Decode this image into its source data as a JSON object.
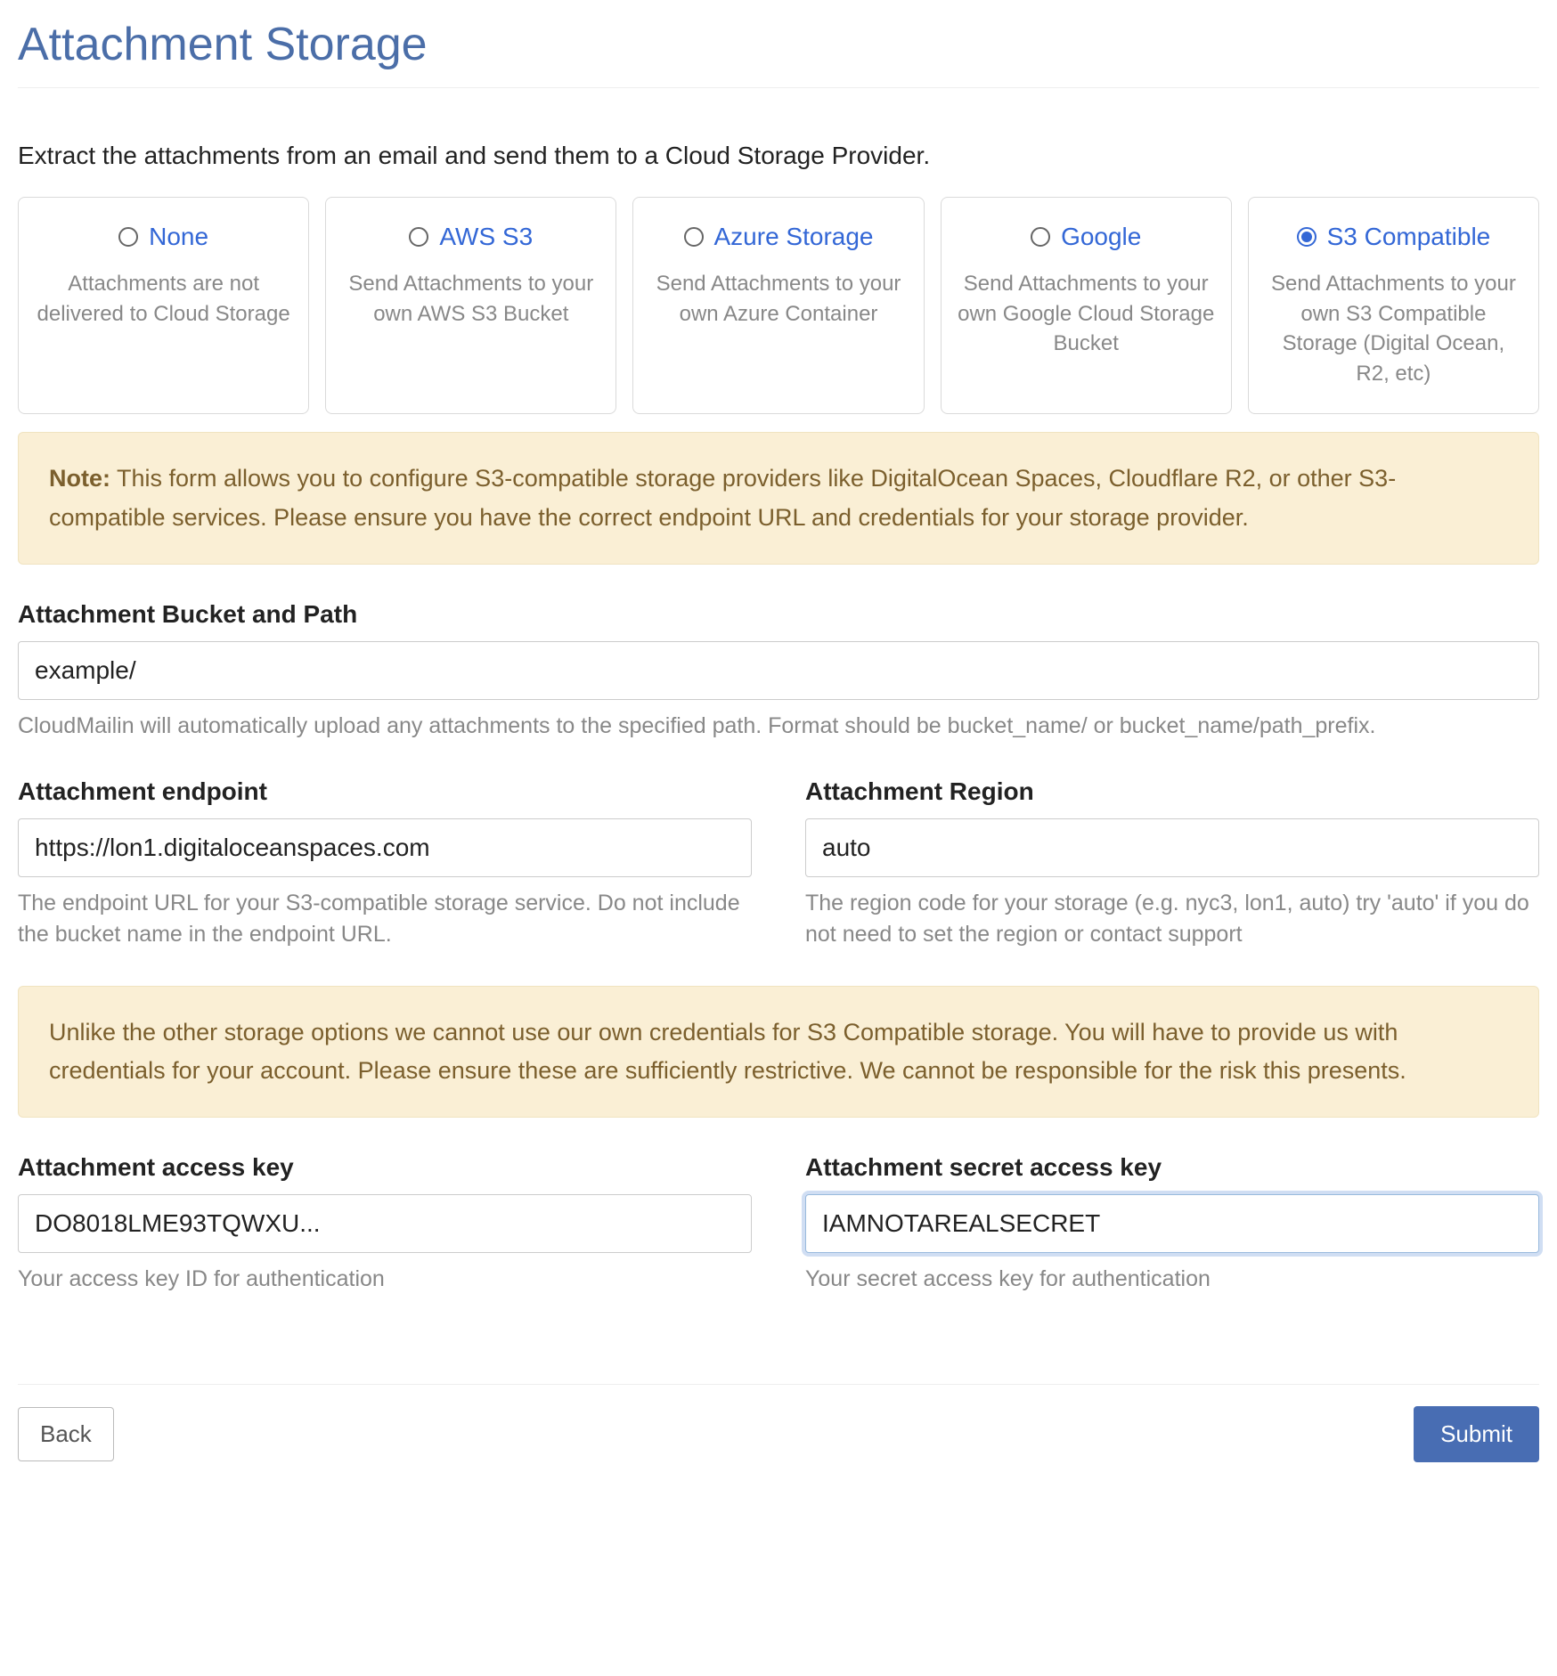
{
  "page": {
    "title": "Attachment Storage",
    "description": "Extract the attachments from an email and send them to a Cloud Storage Provider."
  },
  "providers": [
    {
      "title": "None",
      "desc": "Attachments are not delivered to Cloud Storage",
      "selected": false
    },
    {
      "title": "AWS S3",
      "desc": "Send Attachments to your own AWS S3 Bucket",
      "selected": false
    },
    {
      "title": "Azure Storage",
      "desc": "Send Attachments to your own Azure Container",
      "selected": false
    },
    {
      "title": "Google",
      "desc": "Send Attachments to your own Google Cloud Storage Bucket",
      "selected": false
    },
    {
      "title": "S3 Compatible",
      "desc": "Send Attachments to your own S3 Compatible Storage (Digital Ocean, R2, etc)",
      "selected": true
    }
  ],
  "note": {
    "label": "Note:",
    "text": " This form allows you to configure S3-compatible storage providers like DigitalOcean Spaces, Cloudflare R2, or other S3-compatible services. Please ensure you have the correct endpoint URL and credentials for your storage provider."
  },
  "fields": {
    "bucket": {
      "label": "Attachment Bucket and Path",
      "value": "example/",
      "help": "CloudMailin will automatically upload any attachments to the specified path. Format should be bucket_name/ or bucket_name/path_prefix."
    },
    "endpoint": {
      "label": "Attachment endpoint",
      "value": "https://lon1.digitaloceanspaces.com",
      "help": "The endpoint URL for your S3-compatible storage service. Do not include the bucket name in the endpoint URL."
    },
    "region": {
      "label": "Attachment Region",
      "value": "auto",
      "help": "The region code for your storage (e.g. nyc3, lon1, auto) try 'auto' if you do not need to set the region or contact support"
    },
    "access_key": {
      "label": "Attachment access key",
      "value": "DO8018LME93TQWXU...",
      "help": "Your access key ID for authentication"
    },
    "secret_key": {
      "label": "Attachment secret access key",
      "value": "IAMNOTAREALSECRET",
      "help": "Your secret access key for authentication"
    }
  },
  "credentials_note": "Unlike the other storage options we cannot use our own credentials for S3 Compatible storage. You will have to provide us with credentials for your account. Please ensure these are sufficiently restrictive. We cannot be responsible for the risk this presents.",
  "buttons": {
    "back": "Back",
    "submit": "Submit"
  }
}
